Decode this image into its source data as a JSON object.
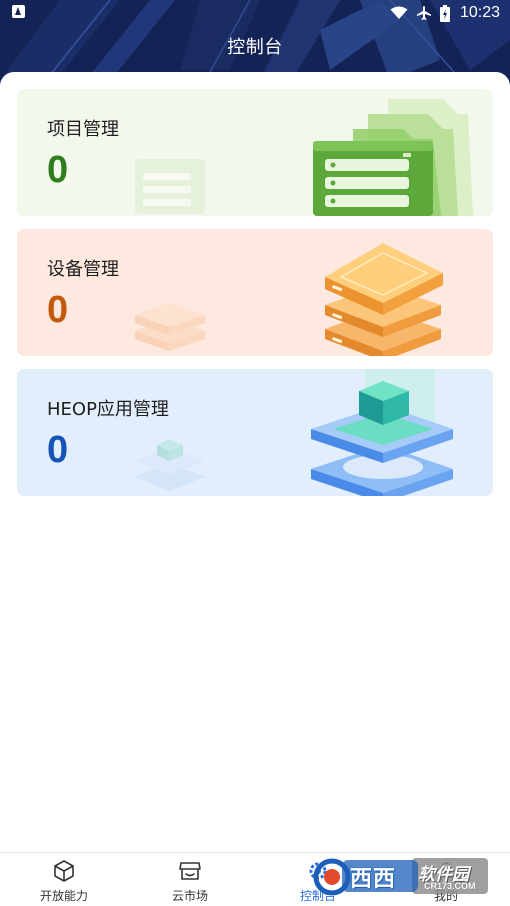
{
  "status_bar": {
    "time": "10:23"
  },
  "header": {
    "title": "控制台"
  },
  "cards": [
    {
      "label": "项目管理",
      "count": "0",
      "accent": "#2f7d1d",
      "background": "#f2f8eb",
      "illustration": "folder-server-icon"
    },
    {
      "label": "设备管理",
      "count": "0",
      "accent": "#c35a0b",
      "background": "#fde9e0",
      "illustration": "stacked-servers-icon"
    },
    {
      "label": "HEOP应用管理",
      "count": "0",
      "accent": "#1652b8",
      "background": "#e3eefc",
      "illustration": "cube-platform-icon"
    }
  ],
  "bottom_nav": {
    "items": [
      {
        "label": "开放能力",
        "icon": "cube-icon"
      },
      {
        "label": "云市场",
        "icon": "store-icon"
      },
      {
        "label": "控制台",
        "icon": "gear-icon",
        "active": true
      },
      {
        "label": "我的",
        "icon": "user-icon"
      }
    ],
    "active_color": "#2b6de0"
  },
  "watermark": {
    "text": "西西",
    "text2": "软件园",
    "domain": "CR173.COM"
  }
}
